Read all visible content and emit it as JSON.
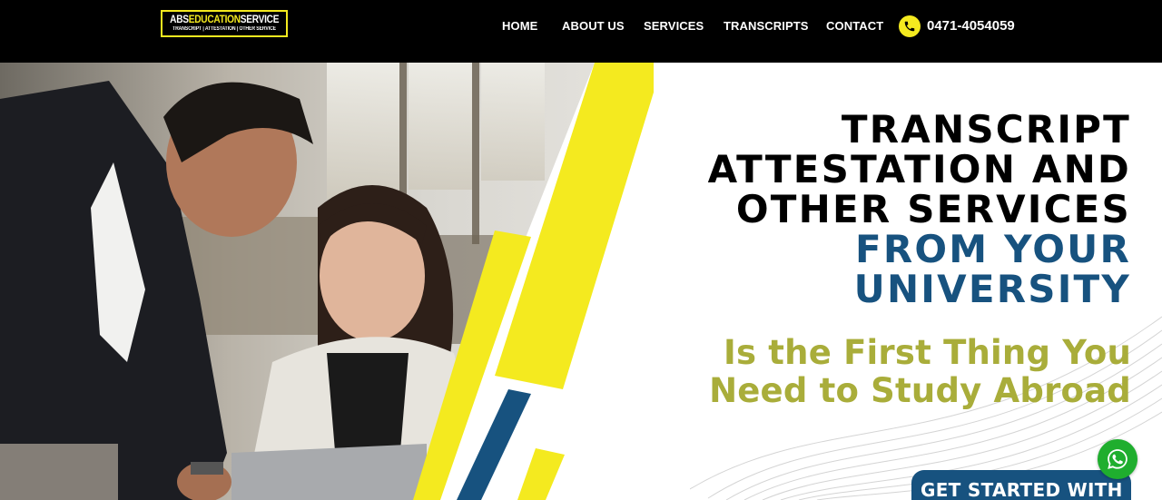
{
  "brand": {
    "logo_part1": "ABS",
    "logo_part2": "EDUCATION",
    "logo_part3": "SERVICE",
    "tagline": "TRANSCRIPT | ATTESTATION | OTHER SERVICE"
  },
  "nav": {
    "items": [
      {
        "label": "HOME"
      },
      {
        "label": "ABOUT US"
      },
      {
        "label": "SERVICES"
      },
      {
        "label": "TRANSCRIPTS"
      },
      {
        "label": "CONTACT"
      }
    ],
    "phone": "0471-4054059"
  },
  "hero": {
    "heading_lines": [
      "TRANSCRIPT",
      "ATTESTATION AND",
      "OTHER SERVICES"
    ],
    "heading_highlight_lines": [
      "FROM YOUR",
      "UNIVERSITY"
    ],
    "subheading_lines": [
      "Is the First Thing You",
      "Need to Study Abroad"
    ],
    "cta_label": "GET STARTED WITH"
  },
  "colors": {
    "accent_yellow": "#f4ea1f",
    "brand_blue": "#17527f",
    "olive": "#a9ad3a",
    "whatsapp_green": "#1fae2e"
  },
  "icons": {
    "phone": "phone-icon",
    "whatsapp": "whatsapp-icon"
  }
}
